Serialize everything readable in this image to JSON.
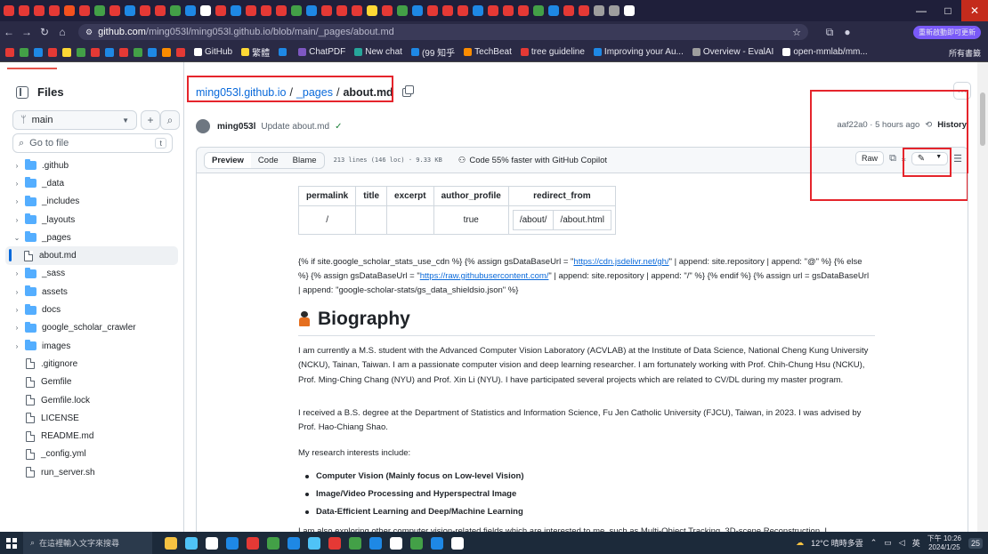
{
  "browser": {
    "tab_colors": [
      "#e53935",
      "#e53935",
      "#e53935",
      "#e53935",
      "#f4511e",
      "#e53935",
      "#43a047",
      "#e53935",
      "#1e88e5",
      "#e53935",
      "#e53935",
      "#43a047",
      "#1e88e5",
      "#ffffff",
      "#e53935",
      "#1e88e5",
      "#e53935",
      "#e53935",
      "#e53935",
      "#43a047",
      "#1e88e5",
      "#e53935",
      "#e53935",
      "#e53935",
      "#fdd835",
      "#e53935",
      "#43a047",
      "#1e88e5",
      "#e53935",
      "#e53935",
      "#e53935",
      "#1e88e5",
      "#e53935",
      "#e53935",
      "#e53935",
      "#43a047",
      "#1e88e5",
      "#e53935",
      "#e53935",
      "#9e9e9e",
      "#9e9e9e",
      "#ffffff"
    ],
    "window_controls": {
      "minimize": "—",
      "maximize": "□",
      "close": "✕"
    },
    "address": {
      "host": "github.com",
      "path": "/ming053l/ming053l.github.io/blob/main/_pages/about.md"
    },
    "update_button": "重新啟動即可更新",
    "bookmarks": [
      {
        "label": "GitHub",
        "color": "#ffffff"
      },
      {
        "label": "繁體",
        "color": "#fdd835"
      },
      {
        "label": "",
        "color": "#1e88e5"
      },
      {
        "label": "ChatPDF",
        "color": "#7e57c2"
      },
      {
        "label": "New chat",
        "color": "#26a69a"
      },
      {
        "label": "(99 知乎",
        "color": "#1e88e5"
      },
      {
        "label": "TechBeat",
        "color": "#fb8c00"
      },
      {
        "label": "tree guideline",
        "color": "#e53935"
      },
      {
        "label": "Improving your Au...",
        "color": "#1e88e5"
      },
      {
        "label": "Overview - EvalAI",
        "color": "#9e9e9e"
      },
      {
        "label": "open-mmlab/mm...",
        "color": "#ffffff"
      }
    ],
    "all_bookmarks": "所有書籤"
  },
  "sidebar": {
    "title": "Files",
    "branch": "main",
    "goto_placeholder": "Go to file",
    "goto_key": "t",
    "tree": [
      {
        "label": ".github",
        "type": "folder",
        "open": false,
        "indent": 0
      },
      {
        "label": "_data",
        "type": "folder",
        "open": false,
        "indent": 0
      },
      {
        "label": "_includes",
        "type": "folder",
        "open": false,
        "indent": 0
      },
      {
        "label": "_layouts",
        "type": "folder",
        "open": false,
        "indent": 0
      },
      {
        "label": "_pages",
        "type": "folder",
        "open": true,
        "indent": 0
      },
      {
        "label": "about.md",
        "type": "file",
        "selected": true,
        "indent": 1
      },
      {
        "label": "_sass",
        "type": "folder",
        "open": false,
        "indent": 0
      },
      {
        "label": "assets",
        "type": "folder",
        "open": false,
        "indent": 0
      },
      {
        "label": "docs",
        "type": "folder",
        "open": false,
        "indent": 0
      },
      {
        "label": "google_scholar_crawler",
        "type": "folder",
        "open": false,
        "indent": 0
      },
      {
        "label": "images",
        "type": "folder",
        "open": false,
        "indent": 0
      },
      {
        "label": ".gitignore",
        "type": "file",
        "indent": 0
      },
      {
        "label": "Gemfile",
        "type": "file",
        "indent": 0
      },
      {
        "label": "Gemfile.lock",
        "type": "file",
        "indent": 0
      },
      {
        "label": "LICENSE",
        "type": "file",
        "indent": 0
      },
      {
        "label": "README.md",
        "type": "file",
        "indent": 0
      },
      {
        "label": "_config.yml",
        "type": "file",
        "indent": 0
      },
      {
        "label": "run_server.sh",
        "type": "file",
        "indent": 0
      }
    ]
  },
  "breadcrumb": {
    "repo": "ming053l.github.io",
    "sep": "/",
    "folder": "_pages",
    "file": "about.md"
  },
  "commit": {
    "author": "ming053l",
    "message": "Update about.md",
    "hash_time": "aaf22a0 · 5 hours ago",
    "history": "History"
  },
  "file_bar": {
    "tabs": [
      "Preview",
      "Code",
      "Blame"
    ],
    "stats": "213 lines (146 loc) · 9.33 KB",
    "copilot": "Code 55% faster with GitHub Copilot",
    "raw": "Raw"
  },
  "front_matter": {
    "headers": [
      "permalink",
      "title",
      "excerpt",
      "author_profile",
      "redirect_from"
    ],
    "row": {
      "permalink": "/",
      "title": "",
      "excerpt": "",
      "author_profile": "true",
      "redirect": [
        "/about/",
        "/about.html"
      ]
    }
  },
  "liquid": {
    "a": "{% if site.google_scholar_stats_use_cdn %} {% assign gsDataBaseUrl = \"",
    "link1": "https://cdn.jsdelivr.net/gh/",
    "b": "\" | append: site.repository | append: \"@\" %} {% else %} {% assign gsDataBaseUrl = \"",
    "link2": "https://raw.githubusercontent.com/",
    "c": "\" | append: site.repository | append: \"/\" %} {% endif %} {% assign url = gsDataBaseUrl | append: \"google-scholar-stats/gs_data_shieldsio.json\" %}"
  },
  "biography": {
    "heading": "Biography",
    "p1": "I am currently a M.S. student with the Advanced Computer Vision Laboratory (ACVLAB) at the Institute of Data Science, National Cheng Kung University (NCKU), Tainan, Taiwan. I am a passionate computer vision and deep learning researcher. I am fortunately working with Prof. Chih-Chung Hsu (NCKU), Prof. Ming-Ching Chang (NYU) and Prof. Xin Li (NYU). I have participated several projects which are related to CV/DL during my master program.",
    "p2": "I received a B.S. degree at the Department of Statistics and Information Science, Fu Jen Catholic University (FJCU), Taiwan, in 2023. I was advised by Prof. Hao-Chiang Shao.",
    "p3": "My research interests include:",
    "interests": [
      "Computer Vision (Mainly focus on Low-level Vision)",
      "Image/Video Processing and Hyperspectral Image",
      "Data-Efficient Learning and Deep/Machine Learning"
    ],
    "p4": "I am also exploring other computer vision-related fields which are interested to me, such as Multi-Object Tracking, 3D-scene Reconstruction. I"
  },
  "taskbar": {
    "search": "在這裡輸入文字來搜尋",
    "app_colors": [
      "#f5c242",
      "#4fc3f7",
      "#ffffff",
      "#1e88e5",
      "#e53935",
      "#43a047",
      "#1e88e5",
      "#4fc3f7",
      "#e53935",
      "#43a047",
      "#1e88e5",
      "#ffffff",
      "#43a047",
      "#1e88e5",
      "#ffffff"
    ],
    "weather": "12°C 晴時多雲",
    "ime": "英",
    "time": "下午 10:26",
    "date": "2024/1/25",
    "notif": "25"
  }
}
